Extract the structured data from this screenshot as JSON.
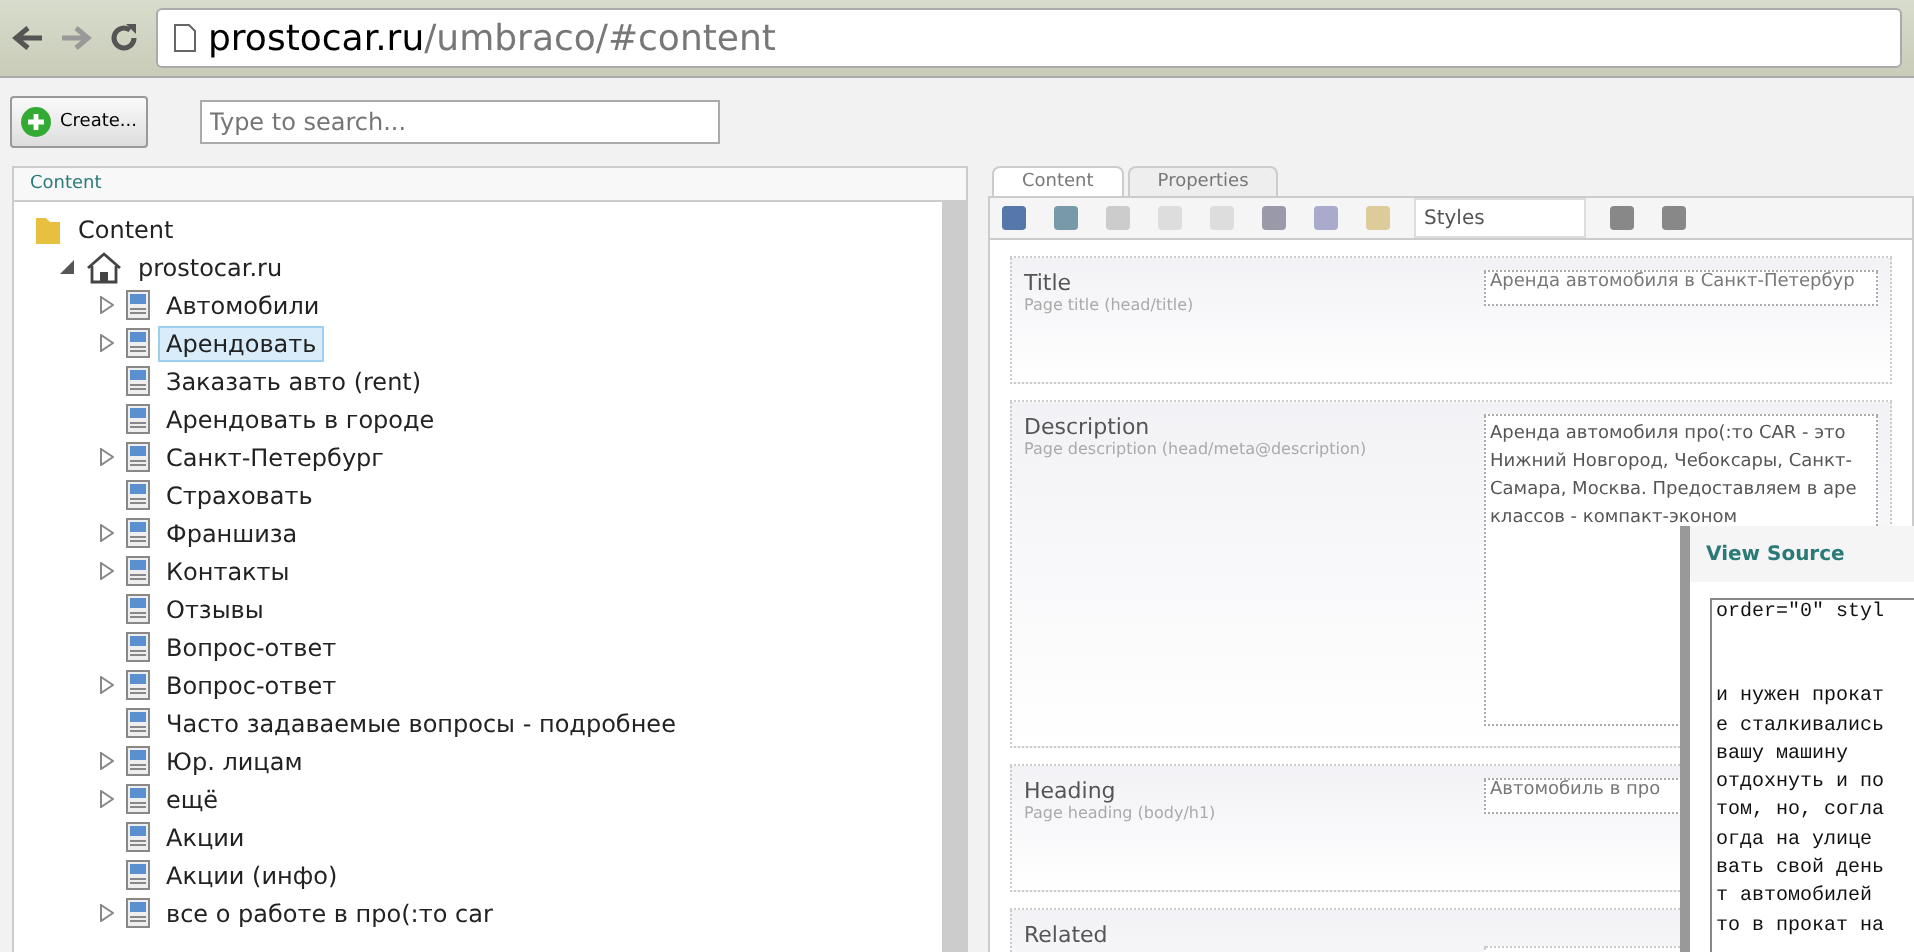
{
  "browser": {
    "url_host": "prostocar.ru",
    "url_path": "/umbraco/#content"
  },
  "toolbar": {
    "create_label": "Create...",
    "search": {
      "placeholder": "Type to search..."
    }
  },
  "tree": {
    "title": "Content",
    "root": {
      "label": "Content",
      "children": [
        {
          "label": "prostocar.ru",
          "expanded": true,
          "children": [
            {
              "label": "Автомобили",
              "has_children": true,
              "selected": false
            },
            {
              "label": "Арендовать",
              "has_children": true,
              "selected": true
            },
            {
              "label": "Заказать авто (rent)",
              "has_children": false,
              "selected": false
            },
            {
              "label": "Арендовать в городе",
              "has_children": false,
              "selected": false
            },
            {
              "label": "Санкт-Петербург",
              "has_children": true,
              "selected": false
            },
            {
              "label": "Страховать",
              "has_children": false,
              "selected": false
            },
            {
              "label": "Франшиза",
              "has_children": true,
              "selected": false
            },
            {
              "label": "Контакты",
              "has_children": true,
              "selected": false
            },
            {
              "label": "Отзывы",
              "has_children": false,
              "selected": false
            },
            {
              "label": "Вопрос-ответ",
              "has_children": false,
              "selected": false
            },
            {
              "label": "Вопрос-ответ",
              "has_children": true,
              "selected": false
            },
            {
              "label": "Часто задаваемые вопросы - подробнее",
              "has_children": false,
              "selected": false
            },
            {
              "label": "Юр. лицам",
              "has_children": true,
              "selected": false
            },
            {
              "label": "ещё",
              "has_children": true,
              "selected": false
            },
            {
              "label": "Акции",
              "has_children": false,
              "selected": false
            },
            {
              "label": "Акции (инфо)",
              "has_children": false,
              "selected": false
            },
            {
              "label": "все о работе в про(:то car",
              "has_children": true,
              "selected": false
            }
          ]
        }
      ]
    }
  },
  "editor": {
    "tabs": [
      {
        "label": "Content",
        "selected": true
      },
      {
        "label": "Properties",
        "selected": false
      }
    ],
    "styles_select": "Styles",
    "fields": [
      {
        "kind": "input",
        "label": "Title",
        "hint": "Page title (head/title)",
        "value": "Аренда автомобиля в Санкт-Петербур"
      },
      {
        "kind": "textarea",
        "label": "Description",
        "hint": "Page description (head/meta@description)",
        "lines": [
          "Аренда автомобиля про(:то CAR - это",
          "Нижний Новгород, Чебоксары, Санкт-",
          "Самара, Москва. Предоставляем в аре",
          "классов - компакт-эконом"
        ]
      },
      {
        "kind": "input",
        "label": "Heading",
        "hint": "Page heading (body/h1)",
        "value": "Автомобиль в про"
      },
      {
        "kind": "related",
        "label": "Related"
      }
    ]
  },
  "view_source": {
    "title": "View Source",
    "first_line": "order=\"0\" styl",
    "lines": [
      "и нужен прокат",
      "е сталкивались",
      "вашу машину",
      "отдохнуть и по",
      "том, но, согла",
      "огда на улице",
      "вать свой день",
      "т автомобилей",
      "то в прокат на"
    ]
  }
}
